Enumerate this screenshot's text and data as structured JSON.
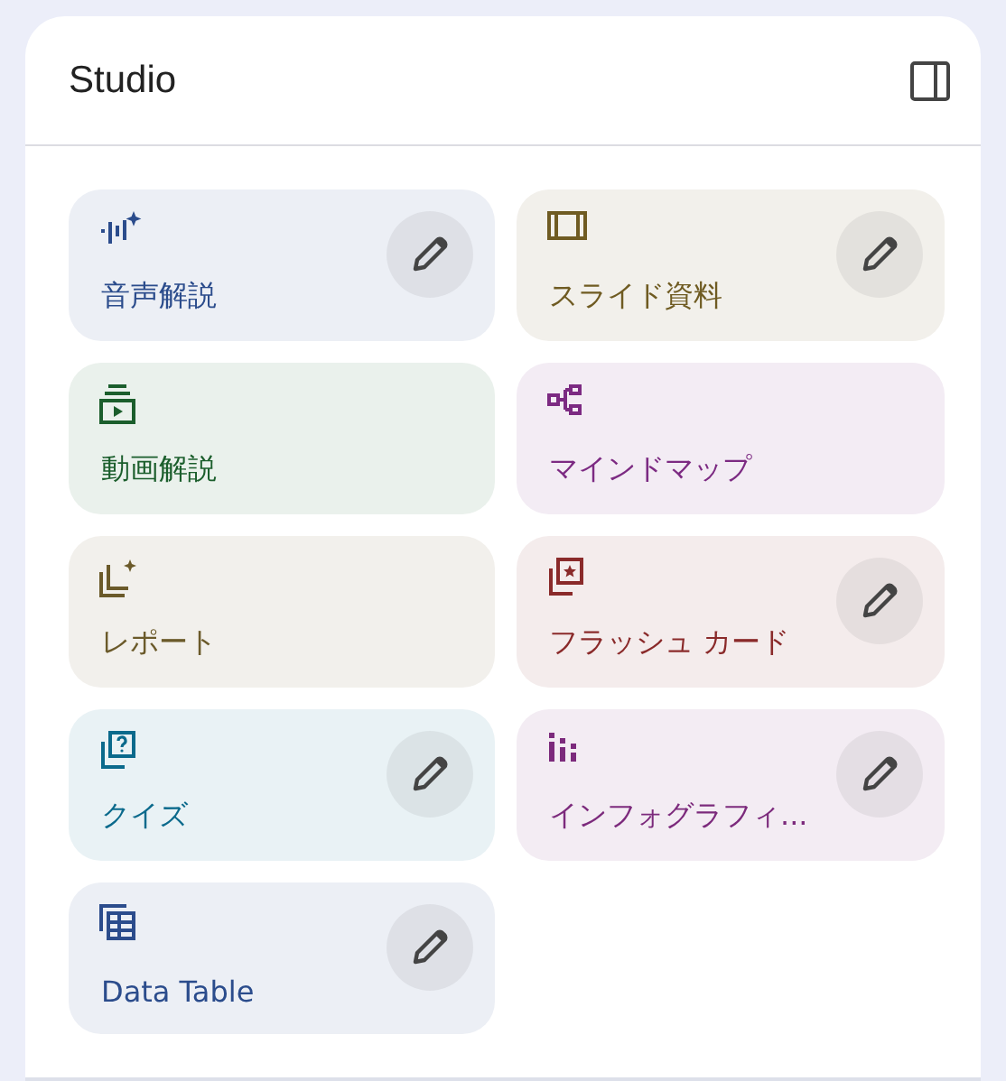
{
  "panel": {
    "title": "Studio"
  },
  "cards": [
    {
      "kind": "audio",
      "label": "音声解説",
      "color": "#2b4c8c",
      "editable": true
    },
    {
      "kind": "slides",
      "label": "スライド資料",
      "color": "#6f5b22",
      "editable": true
    },
    {
      "kind": "video",
      "label": "動画解説",
      "color": "#1b5e2c",
      "editable": false
    },
    {
      "kind": "mindmap",
      "label": "マインドマップ",
      "color": "#7c2a82",
      "editable": false
    },
    {
      "kind": "report",
      "label": "レポート",
      "color": "#6b5a2a",
      "editable": false
    },
    {
      "kind": "flashcards",
      "label": "フラッシュ カード",
      "color": "#8a2a2a",
      "editable": true
    },
    {
      "kind": "quiz",
      "label": "クイズ",
      "color": "#0b6a8c",
      "editable": true
    },
    {
      "kind": "infographic",
      "label": "インフォグラフィ...",
      "color": "#7c2a7c",
      "editable": true
    },
    {
      "kind": "table",
      "label": "Data Table",
      "color": "#2b4c8c",
      "editable": true
    }
  ]
}
